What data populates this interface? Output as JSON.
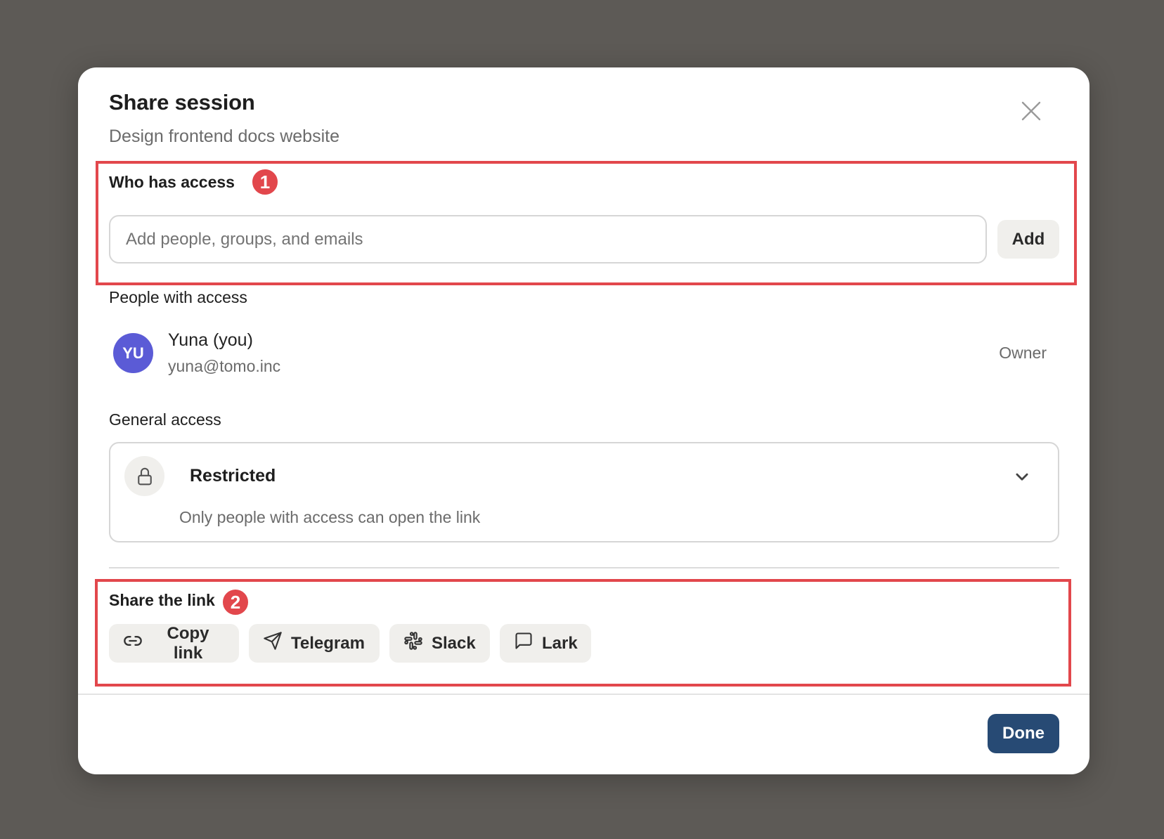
{
  "dialog": {
    "title": "Share session",
    "subtitle": "Design frontend docs website",
    "close_icon": "close-icon"
  },
  "who_has_access": {
    "label": "Who has access",
    "badge": "1",
    "input_placeholder": "Add people, groups, and emails",
    "input_value": "",
    "add_label": "Add"
  },
  "people": {
    "label": "People with access",
    "items": [
      {
        "initials": "YU",
        "name": "Yuna (you)",
        "email": "yuna@tomo.inc",
        "role": "Owner",
        "avatar_color": "#5b5bd6"
      }
    ]
  },
  "general_access": {
    "label": "General access",
    "selected": "Restricted",
    "description": "Only people with access can open the link",
    "icon": "lock-icon"
  },
  "share_link": {
    "label": "Share the link",
    "badge": "2",
    "buttons": [
      {
        "label": "Copy link",
        "icon": "link-icon"
      },
      {
        "label": "Telegram",
        "icon": "send-icon"
      },
      {
        "label": "Slack",
        "icon": "slack-icon"
      },
      {
        "label": "Lark",
        "icon": "message-square-icon"
      }
    ]
  },
  "footer": {
    "done_label": "Done"
  },
  "colors": {
    "backdrop": "#5d5a56",
    "annotation": "#e2474c",
    "primary_button": "#274a74",
    "avatar": "#5b5bd6"
  }
}
